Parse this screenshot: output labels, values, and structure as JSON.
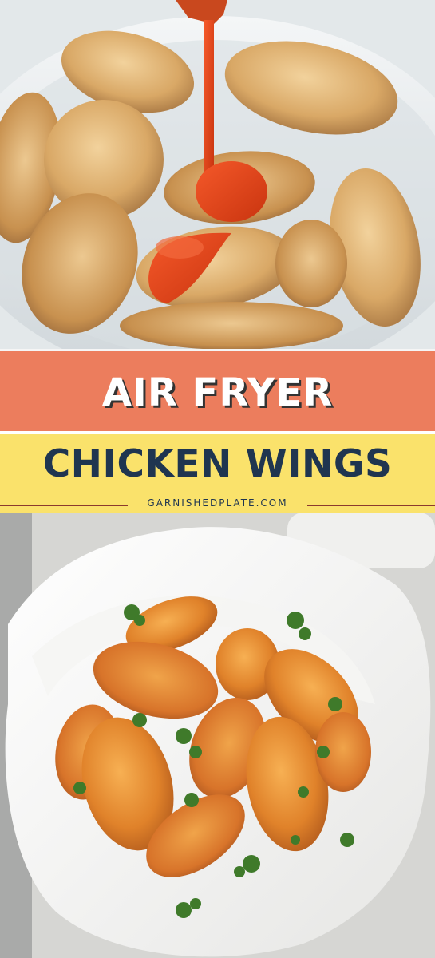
{
  "title_line_1": "AIR FRYER",
  "title_line_2": "CHICKEN WINGS",
  "website": "GARNISHEDPLATE.COM",
  "colors": {
    "orange_band": "#ec7d5d",
    "yellow_band": "#fae26b",
    "navy_text": "#1f3550",
    "sauce": "#e8471b"
  }
}
